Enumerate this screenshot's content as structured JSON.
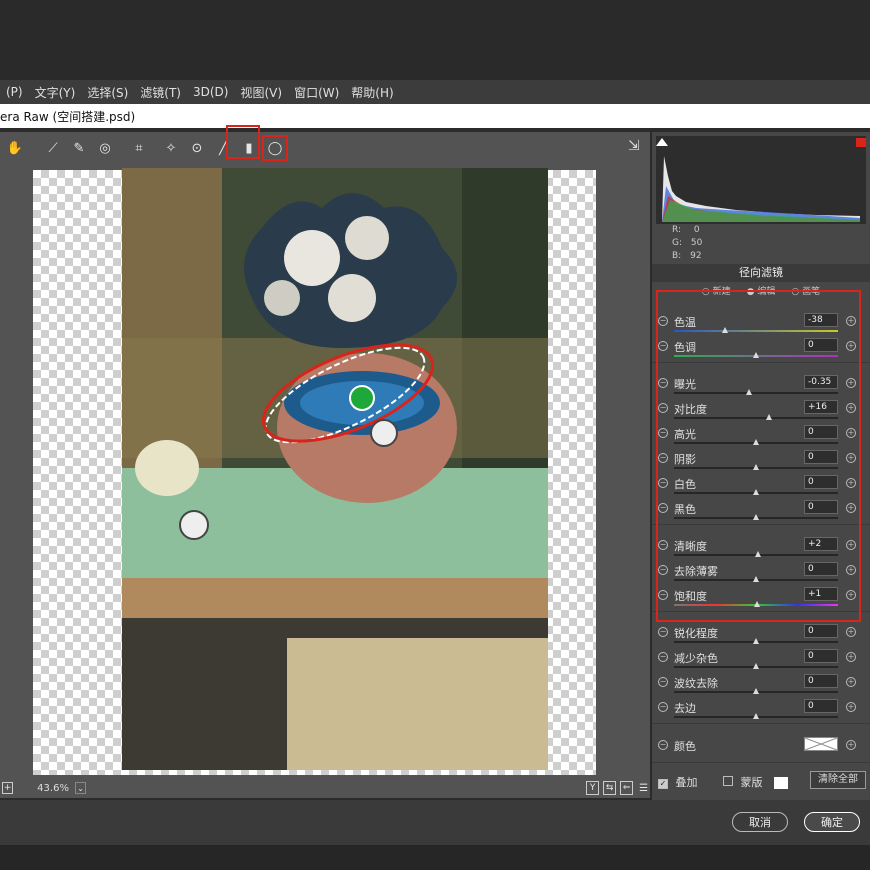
{
  "menu": [
    "(P)",
    "文字(Y)",
    "选择(S)",
    "滤镜(T)",
    "3D(D)",
    "视图(V)",
    "窗口(W)",
    "帮助(H)"
  ],
  "window_title": "era Raw (空间搭建.psd)",
  "zoom_level": "43.6%",
  "rgb": {
    "r_label": "R:",
    "r": "0",
    "g_label": "G:",
    "g": "50",
    "b_label": "B:",
    "b": "92"
  },
  "panel": {
    "title": "径向滤镜",
    "modes": [
      "新建",
      "编辑",
      "画笔"
    ],
    "selected_mode": "编辑",
    "adjustments": [
      {
        "label": "色温",
        "value": "-38",
        "pos": 0.31
      },
      {
        "label": "色调",
        "value": "0",
        "pos": 0.5
      },
      {
        "label": "曝光",
        "value": "-0.35",
        "pos": 0.46
      },
      {
        "label": "对比度",
        "value": "+16",
        "pos": 0.58
      },
      {
        "label": "高光",
        "value": "0",
        "pos": 0.5
      },
      {
        "label": "阴影",
        "value": "0",
        "pos": 0.5
      },
      {
        "label": "白色",
        "value": "0",
        "pos": 0.5
      },
      {
        "label": "黑色",
        "value": "0",
        "pos": 0.5
      },
      {
        "label": "清晰度",
        "value": "+2",
        "pos": 0.51
      },
      {
        "label": "去除薄雾",
        "value": "0",
        "pos": 0.5
      },
      {
        "label": "饱和度",
        "value": "+1",
        "pos": 0.505
      },
      {
        "label": "锐化程度",
        "value": "0",
        "pos": 0.5
      },
      {
        "label": "减少杂色",
        "value": "0",
        "pos": 0.5
      },
      {
        "label": "波纹去除",
        "value": "0",
        "pos": 0.5
      },
      {
        "label": "去边",
        "value": "0",
        "pos": 0.5
      }
    ],
    "color_label": "颜色",
    "overlay_label": "叠加",
    "overlay_checked": true,
    "mask_label": "蒙版",
    "mask_checked": false,
    "clear_all": "清除全部"
  },
  "buttons": {
    "cancel": "取消",
    "ok": "确定"
  },
  "colors": {
    "highlight_red": "#d8241b",
    "pin_green": "#1fa83a"
  }
}
